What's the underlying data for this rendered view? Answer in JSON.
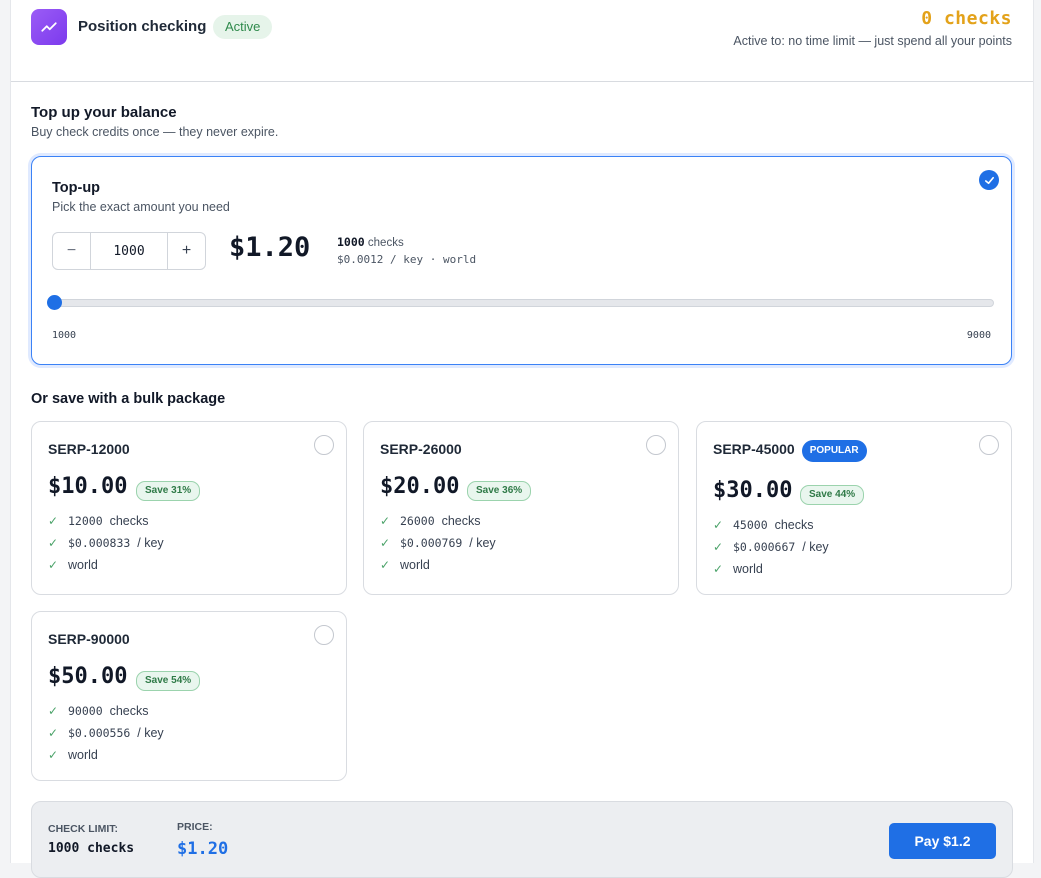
{
  "header": {
    "title": "Position checking",
    "status_badge": "Active",
    "checks_count": "0 checks",
    "active_to": "Active to: no time limit — just spend all your points"
  },
  "topup_section": {
    "title": "Top up your balance",
    "subtitle": "Buy check credits once — they never expire."
  },
  "topup_card": {
    "title": "Top-up",
    "subtitle": "Pick the exact amount you need",
    "selected": true,
    "stepper": {
      "minus": "−",
      "value": "1000",
      "plus": "+"
    },
    "price": "$1.20",
    "checks_value": "1000",
    "checks_unit": "checks",
    "rate": "$0.0012 / key · world",
    "slider": {
      "min_label": "1000",
      "max_label": "9000",
      "min": 1000,
      "max": 9000,
      "value": 1000
    }
  },
  "bulk_section": {
    "title": "Or save with a bulk package"
  },
  "packages": [
    {
      "name": "SERP-12000",
      "popular": "",
      "price": "$10.00",
      "save": "Save 31%",
      "checks": "12000",
      "checks_unit": "checks",
      "rate": "$0.000833",
      "rate_unit": "/ key",
      "region": "world",
      "selected": false
    },
    {
      "name": "SERP-26000",
      "popular": "",
      "price": "$20.00",
      "save": "Save 36%",
      "checks": "26000",
      "checks_unit": "checks",
      "rate": "$0.000769",
      "rate_unit": "/ key",
      "region": "world",
      "selected": false
    },
    {
      "name": "SERP-45000",
      "popular": "POPULAR",
      "price": "$30.00",
      "save": "Save 44%",
      "checks": "45000",
      "checks_unit": "checks",
      "rate": "$0.000667",
      "rate_unit": "/ key",
      "region": "world",
      "selected": false
    },
    {
      "name": "SERP-90000",
      "popular": "",
      "price": "$50.00",
      "save": "Save 54%",
      "checks": "90000",
      "checks_unit": "checks",
      "rate": "$0.000556",
      "rate_unit": "/ key",
      "region": "world",
      "selected": false
    }
  ],
  "footer": {
    "check_limit_label": "CHECK LIMIT:",
    "check_limit_value": "1000 checks",
    "price_label": "PRICE:",
    "price_value": "$1.20",
    "pay_button": "Pay $1.2"
  },
  "icons": {
    "logo": "trending-up-icon",
    "selected": "check-icon",
    "feature": "check-icon"
  },
  "colors": {
    "accent": "#1f6fe5",
    "logo_purple": "#8b5cf6",
    "checks_gold": "#e3a21a",
    "active_green": "#2f8a4c",
    "save_green": "#2f7a47"
  }
}
